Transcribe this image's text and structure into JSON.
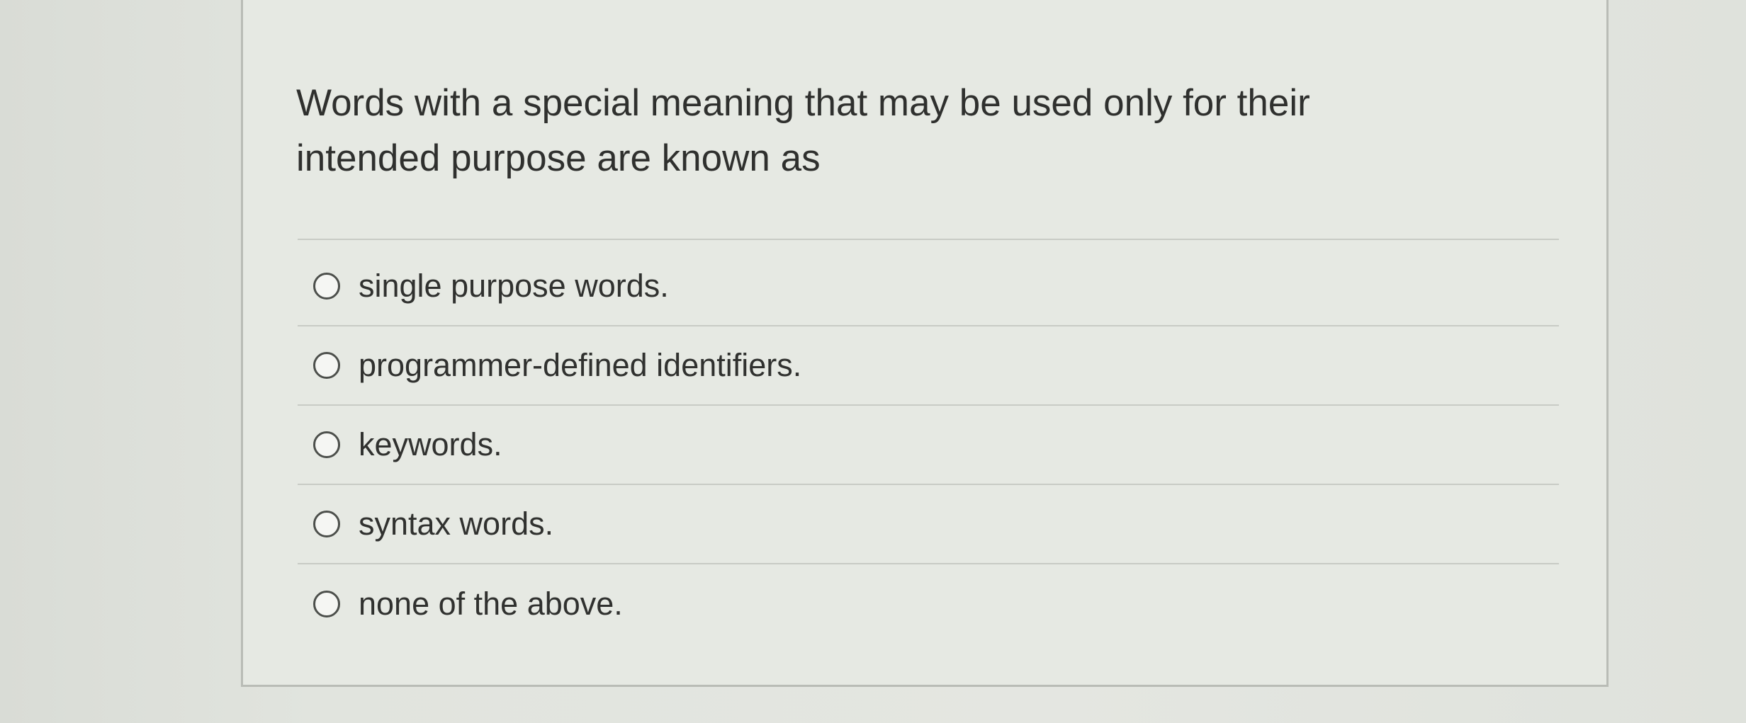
{
  "question": {
    "text": "Words with a special meaning that may be used only for their intended purpose are known as"
  },
  "options": [
    {
      "label": "single purpose words."
    },
    {
      "label": "programmer-defined identifiers."
    },
    {
      "label": "keywords."
    },
    {
      "label": "syntax words."
    },
    {
      "label": "none of the above."
    }
  ],
  "colors": {
    "background": "#e4e6e1",
    "card": "#e6e9e3",
    "text": "#2f302e",
    "divider": "#c8cbc5",
    "radio_border": "#4c4f4b"
  }
}
